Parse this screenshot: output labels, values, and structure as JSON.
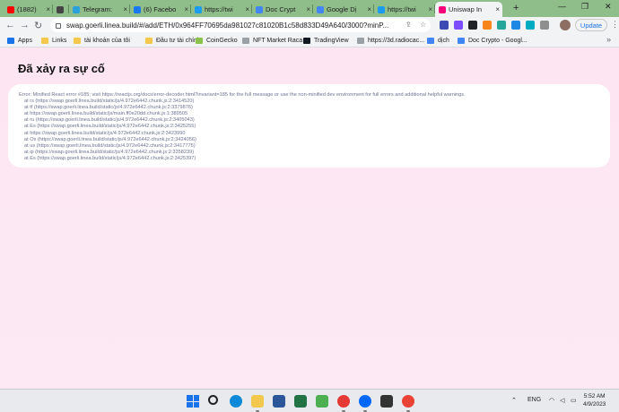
{
  "browser": {
    "tabs": [
      {
        "title": "(1882)",
        "color": "#ff0000"
      },
      {
        "title": "",
        "color": "#444444",
        "icon": "speaker-icon"
      },
      {
        "title": "Telegram:",
        "color": "#2aa1da"
      },
      {
        "title": "(6) Facebo",
        "color": "#1877f2"
      },
      {
        "title": "https://twi",
        "color": "#1d9bf0"
      },
      {
        "title": "Doc Crypt",
        "color": "#4285f4"
      },
      {
        "title": "Google Dị",
        "color": "#4285f4"
      },
      {
        "title": "https://twi",
        "color": "#1d9bf0"
      },
      {
        "title": "Uniswap In",
        "color": "#ff007a",
        "active": true
      }
    ],
    "new_tab": "+",
    "url": "swap.goerli.linea.build/#/add/ETH/0x964FF70695da981027c81020B1c58d833D49A640/3000?minP...",
    "update_label": "Update",
    "bookmarks": [
      {
        "label": "Apps",
        "kind": "apps"
      },
      {
        "label": "Links",
        "kind": "folder"
      },
      {
        "label": "tài khoản của tôi",
        "kind": "folder"
      },
      {
        "label": "Đầu tư tài chính",
        "kind": "folder"
      },
      {
        "label": "CoinGecko",
        "kind": "coingecko"
      },
      {
        "label": "NFT Market Raca",
        "kind": "globe"
      },
      {
        "label": "TradingView",
        "kind": "tradingview"
      },
      {
        "label": "https://3d.radiocac...",
        "kind": "globe"
      },
      {
        "label": "dịch",
        "kind": "google"
      },
      {
        "label": "Doc Crypto - Googl...",
        "kind": "docs"
      }
    ]
  },
  "page": {
    "title": "Đã xảy ra sự cố",
    "error_message": "Error: Minified React error #185; visit https://reactjs.org/docs/error-decoder.html?invariant=185 for the full message or use the non-minified dev environment for full errors and additional helpful warnings.",
    "stack_trace": [
      "at rs (https://swap.goerli.linea.build/static/js/4.972e6442.chunk.js:2:3414520)",
      "at tf (https://swap.goerli.linea.build/static/js/4.972e6442.chunk.js:2:3379876)",
      "at https://swap.goerli.linea.build/static/js/main.ff0e20dd.chunk.js:1:389505",
      "at ru (https://swap.goerli.linea.build/static/js/4.972e6442.chunk.js:2:3405043)",
      "at Es (https://swap.goerli.linea.build/static/js/4.972e6442.chunk.js:2:3425255)",
      "at https://swap.goerli.linea.build/static/js/4.972e6442.chunk.js:2:3423990",
      "at Os (https://swap.goerli.linea.build/static/js/4.972e6442.chunk.js:2:3424056)",
      "at us (https://swap.goerli.linea.build/static/js/4.972e6442.chunk.js:2:3417775)",
      "at qi (https://swap.goerli.linea.build/static/js/4.972e6442.chunk.js:2:3358239)",
      "at Es (https://swap.goerli.linea.build/static/js/4.972e6442.chunk.js:2:3425397)"
    ]
  },
  "taskbar": {
    "language": "ENG",
    "time": "5:52 AM",
    "date": "4/9/2023",
    "apps": [
      {
        "name": "search-icon",
        "color": "#202124"
      },
      {
        "name": "edge-icon",
        "color": "#0c8ad8"
      },
      {
        "name": "file-explorer-icon",
        "color": "#f2c94c"
      },
      {
        "name": "word-icon",
        "color": "#2b579a"
      },
      {
        "name": "excel-icon",
        "color": "#217346"
      },
      {
        "name": "app-icon",
        "color": "#4caf50"
      },
      {
        "name": "chrome-icon",
        "color": "#e53935"
      },
      {
        "name": "zalo-icon",
        "color": "#0068ff"
      },
      {
        "name": "badge-app-icon",
        "color": "#333333"
      },
      {
        "name": "chrome-profile-icon",
        "color": "#ea4335"
      }
    ]
  }
}
